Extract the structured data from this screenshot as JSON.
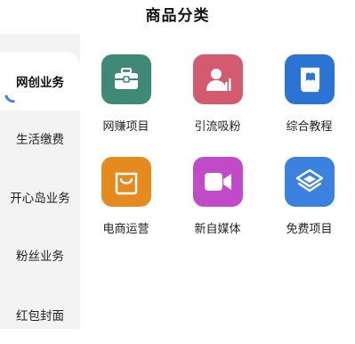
{
  "header": {
    "title": "商品分类"
  },
  "sidebar": {
    "items": [
      {
        "label": "网创业务",
        "active": true
      },
      {
        "label": "生活缴费",
        "active": false
      },
      {
        "label": "开心岛业务",
        "active": false
      },
      {
        "label": "粉丝业务",
        "active": false
      },
      {
        "label": "红包封面",
        "active": false
      }
    ]
  },
  "grid": {
    "items": [
      {
        "label": "网赚项目",
        "icon": "briefcase-icon",
        "color": "#3f8a77"
      },
      {
        "label": "引流吸粉",
        "icon": "user-chart-icon",
        "color": "#d35a6f"
      },
      {
        "label": "综合教程",
        "icon": "book-icon",
        "color": "#2b74d6"
      },
      {
        "label": "电商运营",
        "icon": "shopping-bag-icon",
        "color": "#e58a1f"
      },
      {
        "label": "新自媒体",
        "icon": "video-camera-icon",
        "color": "#c04ac7"
      },
      {
        "label": "免费项目",
        "icon": "layers-icon",
        "color": "#3b82e0"
      }
    ]
  },
  "accent": "#4a7cf0"
}
